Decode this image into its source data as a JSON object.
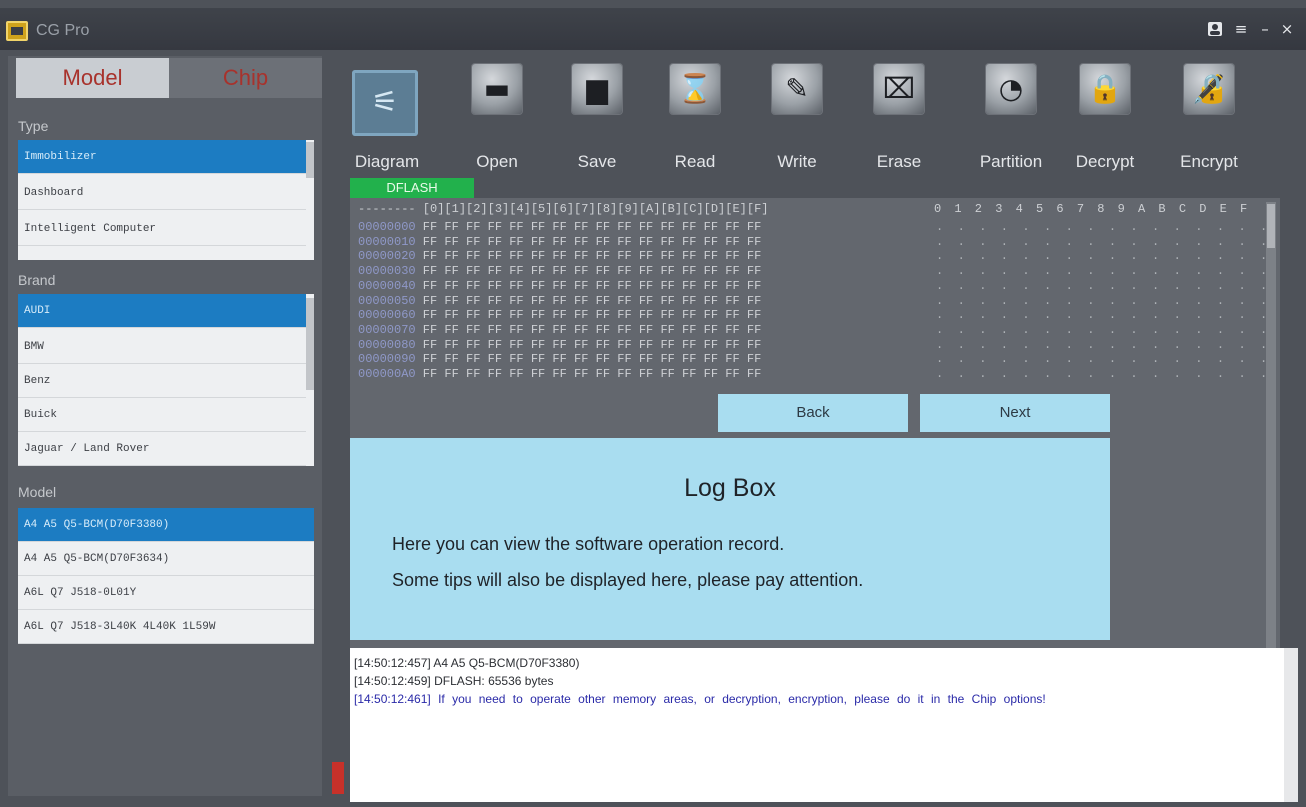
{
  "app": {
    "title": "CG Pro"
  },
  "titlebar": {
    "user_icon": "user-icon",
    "menu_icon": "menu-icon",
    "minimize": "–",
    "close": "×"
  },
  "sidebar": {
    "tabs": [
      {
        "label": "Model"
      },
      {
        "label": "Chip"
      }
    ],
    "type": {
      "label": "Type",
      "items": [
        "Immobilizer",
        "Dashboard",
        "Intelligent Computer"
      ]
    },
    "brand": {
      "label": "Brand",
      "items": [
        "AUDI",
        "BMW",
        "Benz",
        "Buick",
        "Jaguar / Land Rover"
      ]
    },
    "model": {
      "label": "Model",
      "items": [
        "A4 A5 Q5-BCM(D70F3380)",
        "A4 A5 Q5-BCM(D70F3634)",
        "A6L Q7 J518-0L01Y",
        "A6L Q7 J518-3L40K 4L40K 1L59W"
      ]
    }
  },
  "toolbar": {
    "items": [
      {
        "label": "Diagram",
        "icon": "diagram-icon",
        "glyph": "⚟"
      },
      {
        "label": "Open",
        "icon": "folder-icon",
        "glyph": "▬"
      },
      {
        "label": "Save",
        "icon": "floppy-disk-icon",
        "glyph": "▆"
      },
      {
        "label": "Read",
        "icon": "hourglass-icon",
        "glyph": "⌛"
      },
      {
        "label": "Write",
        "icon": "pencil-icon",
        "glyph": "✎"
      },
      {
        "label": "Erase",
        "icon": "eraser-icon",
        "glyph": "⌧"
      },
      {
        "label": "Partition",
        "icon": "pie-chart-icon",
        "glyph": "◔"
      },
      {
        "label": "Decrypt",
        "icon": "lock-icon",
        "glyph": "🔒"
      },
      {
        "label": "Encrypt",
        "icon": "lock-gear-icon",
        "glyph": "🔏"
      }
    ]
  },
  "memory": {
    "area": "DFLASH",
    "header_prefix": "--------",
    "columns": [
      "0",
      "1",
      "2",
      "3",
      "4",
      "5",
      "6",
      "7",
      "8",
      "9",
      "A",
      "B",
      "C",
      "D",
      "E",
      "F"
    ],
    "addresses": [
      "00000000",
      "00000010",
      "00000020",
      "00000030",
      "00000040",
      "00000050",
      "00000060",
      "00000070",
      "00000080",
      "00000090",
      "000000A0"
    ],
    "byte_value": "FF",
    "ascii_char": "."
  },
  "nav": {
    "back": "Back",
    "next": "Next"
  },
  "logbox": {
    "title": "Log Box",
    "line1": "Here you can view the software operation record.",
    "line2": "Some tips will also be displayed here, please pay attention."
  },
  "log": {
    "lines": [
      "[14:50:12:457]  A4  A5  Q5-BCM(D70F3380)",
      "[14:50:12:459]  DFLASH:  65536  bytes",
      "[14:50:12:461]  If you need to operate other memory areas, or decryption, encryption, please do it in the Chip options!"
    ]
  },
  "colors": {
    "selected": "#1c7cc2",
    "dflash": "#22b14c",
    "overlay": "#a9ddf0",
    "accent_red": "#a8322c"
  }
}
